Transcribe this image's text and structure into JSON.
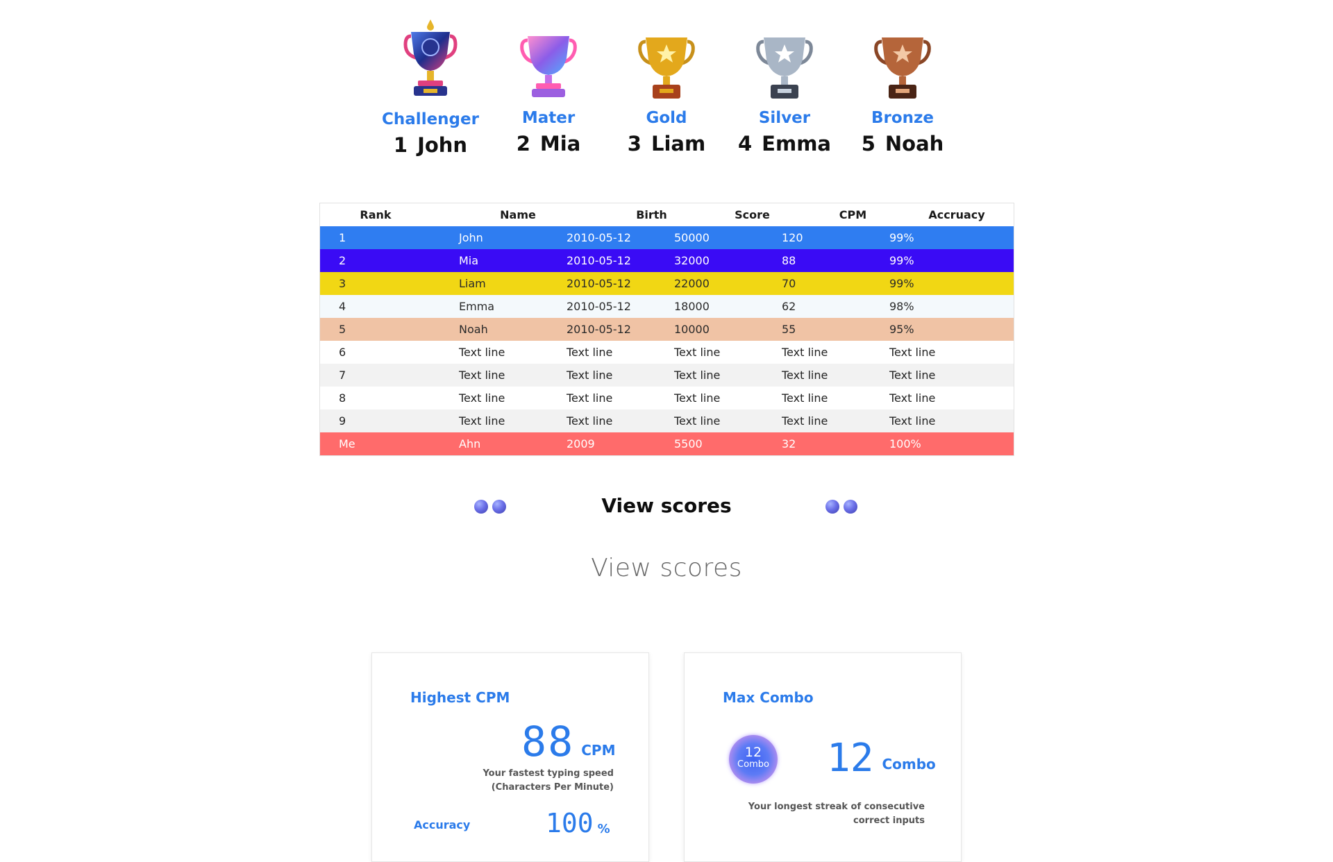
{
  "podium": [
    {
      "tier": "Challenger",
      "rank": "1",
      "name": "John",
      "trophy": "challenger-trophy-icon",
      "cup": "#2d48b8",
      "accent": "#e0407f"
    },
    {
      "tier": "Mater",
      "rank": "2",
      "name": "Mia",
      "trophy": "master-trophy-icon",
      "cup": "#c46ee8",
      "accent": "#ff5db1"
    },
    {
      "tier": "Gold",
      "rank": "3",
      "name": "Liam",
      "trophy": "gold-trophy-icon",
      "cup": "#e3a81c",
      "accent": "#a8411c"
    },
    {
      "tier": "Silver",
      "rank": "4",
      "name": "Emma",
      "trophy": "silver-trophy-icon",
      "cup": "#a9b6c6",
      "accent": "#3b4250"
    },
    {
      "tier": "Bronze",
      "rank": "5",
      "name": "Noah",
      "trophy": "bronze-trophy-icon",
      "cup": "#b5653a",
      "accent": "#4a2415"
    }
  ],
  "table": {
    "headers": [
      "Rank",
      "Name",
      "Birth",
      "Score",
      "CPM",
      "Accruacy"
    ],
    "rows": [
      [
        "1",
        "John",
        "2010-05-12",
        "50000",
        "120",
        "99%"
      ],
      [
        "2",
        "Mia",
        "2010-05-12",
        "32000",
        "88",
        "99%"
      ],
      [
        "3",
        "Liam",
        "2010-05-12",
        "22000",
        "70",
        "99%"
      ],
      [
        "4",
        "Emma",
        "2010-05-12",
        "18000",
        "62",
        "98%"
      ],
      [
        "5",
        "Noah",
        "2010-05-12",
        "10000",
        "55",
        "95%"
      ],
      [
        "6",
        "Text line",
        "Text line",
        "Text line",
        "Text line",
        "Text line"
      ],
      [
        "7",
        "Text line",
        "Text line",
        "Text line",
        "Text line",
        "Text line"
      ],
      [
        "8",
        "Text line",
        "Text line",
        "Text line",
        "Text line",
        "Text line"
      ],
      [
        "9",
        "Text line",
        "Text line",
        "Text line",
        "Text line",
        "Text line"
      ],
      [
        "Me",
        "Ahn",
        "2009",
        "5500",
        "32",
        "100%"
      ]
    ]
  },
  "section": {
    "title": "View scores",
    "subtitle": "View scores"
  },
  "cards": {
    "cpm": {
      "title": "Highest CPM",
      "value": "88",
      "unit": "CPM",
      "desc_line1": "Your fastest typing speed",
      "desc_line2": "(Characters Per Minute)",
      "accuracy_label": "Accuracy",
      "accuracy_value": "100",
      "accuracy_unit": "%"
    },
    "combo": {
      "title": "Max Combo",
      "orb_value": "12",
      "orb_label": "Combo",
      "value": "12",
      "unit": "Combo",
      "desc_line1": "Your longest streak of consecutive",
      "desc_line2": "correct inputs"
    }
  },
  "colors": {
    "accent": "#2b7bea",
    "me_row": "#ff6b6b"
  }
}
